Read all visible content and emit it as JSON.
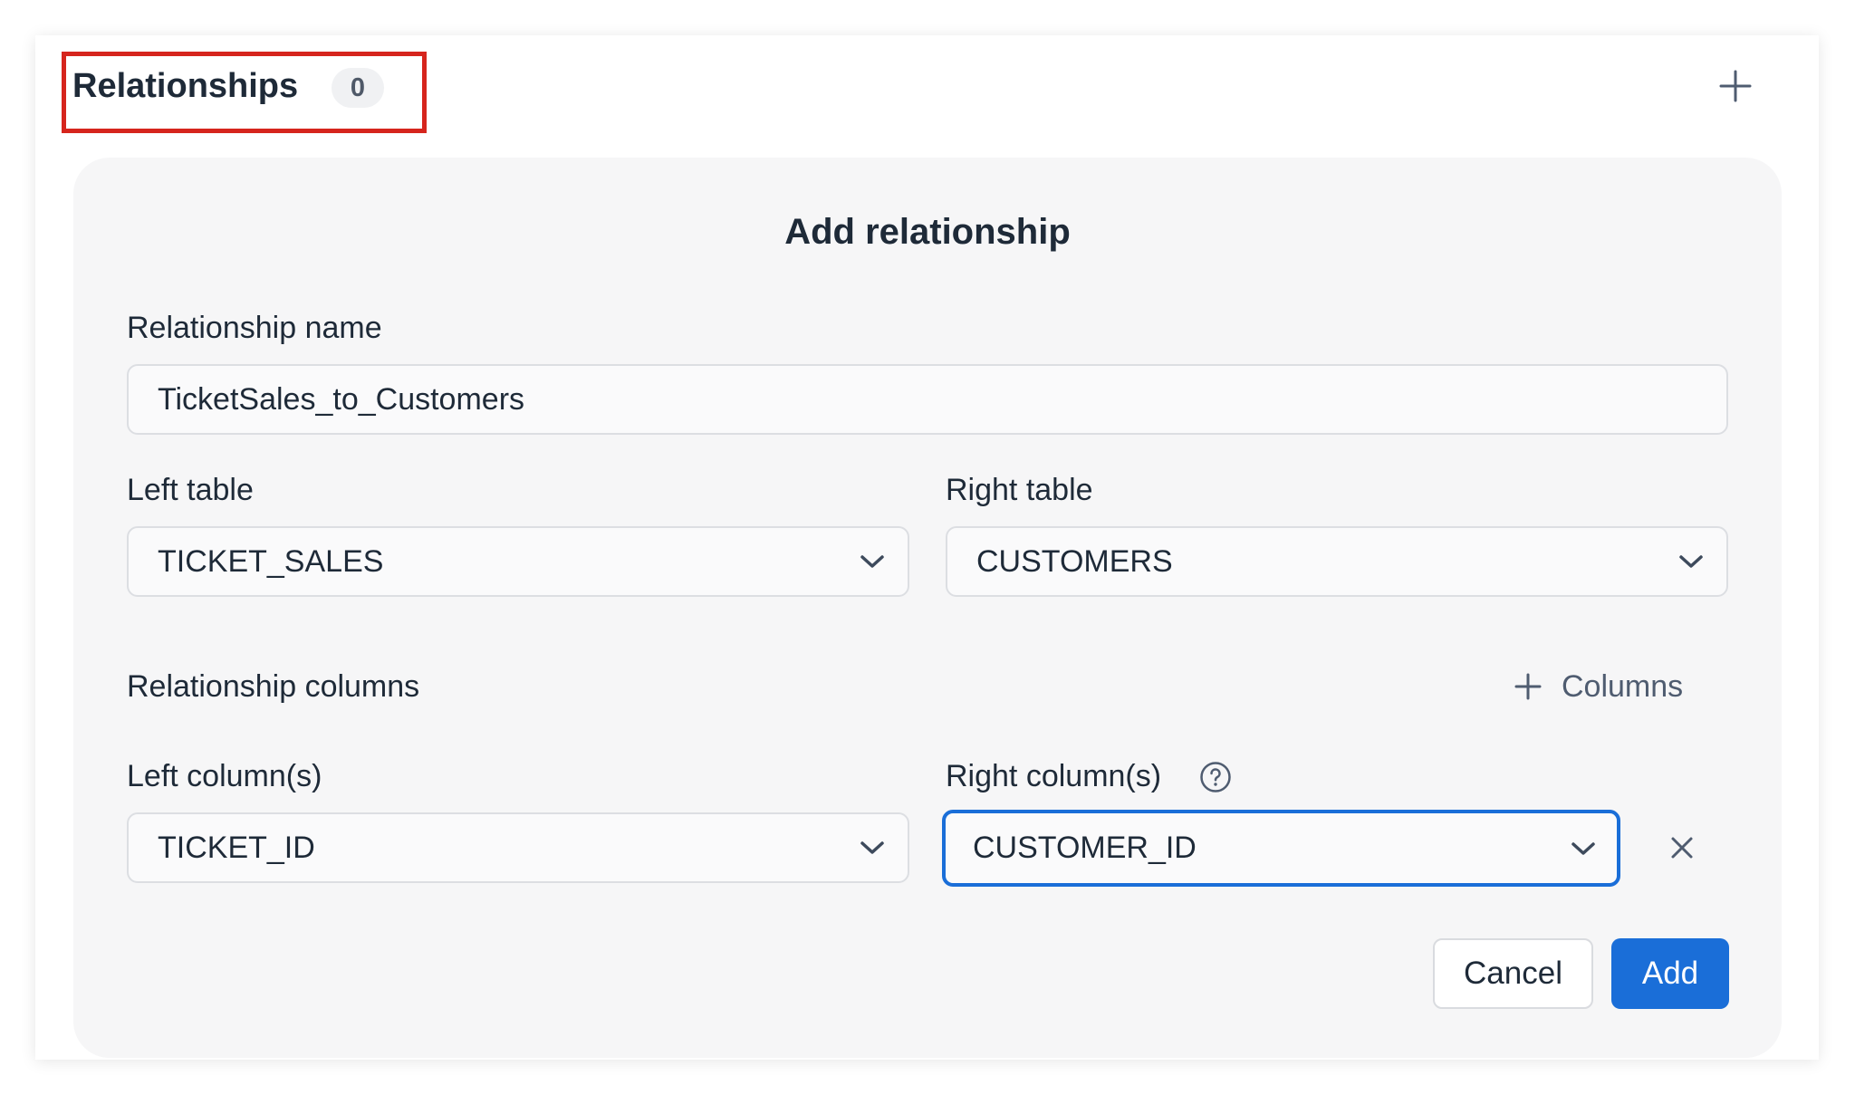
{
  "header": {
    "title": "Relationships",
    "count": "0",
    "add_icon": "plus-icon"
  },
  "form": {
    "title": "Add relationship",
    "relationship_name": {
      "label": "Relationship name",
      "value": "TicketSales_to_Customers"
    },
    "left_table": {
      "label": "Left table",
      "value": "TICKET_SALES"
    },
    "right_table": {
      "label": "Right table",
      "value": "CUSTOMERS"
    },
    "columns_section": {
      "label": "Relationship columns",
      "add_label": "Columns"
    },
    "left_columns": {
      "label": "Left column(s)",
      "value": "TICKET_ID"
    },
    "right_columns": {
      "label": "Right column(s)",
      "value": "CUSTOMER_ID",
      "help_icon": "question-circle-icon"
    },
    "remove_icon": "close-icon",
    "cancel_label": "Cancel",
    "add_label": "Add"
  },
  "colors": {
    "primary": "#1a6ed8",
    "highlight": "#d6251d",
    "panel_bg": "#f6f6f7"
  }
}
